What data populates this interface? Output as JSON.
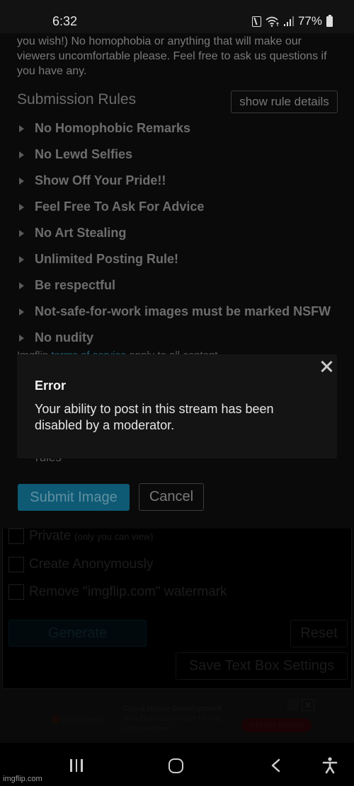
{
  "status_bar": {
    "time": "6:32",
    "battery_percent": "77%",
    "icons": [
      "nfc-icon",
      "wifi-icon",
      "signal-icon",
      "battery-icon"
    ]
  },
  "page": {
    "intro_text": "you wish!) No homophobia or anything that will make our viewers uncomfortable please. Feel free to ask us questions if you have any.",
    "rules_title": "Submission Rules",
    "show_rules_button": "show rule details",
    "rules": [
      {
        "label": "No Homophobic Remarks"
      },
      {
        "label": "No Lewd Selfies"
      },
      {
        "label": "Show Off Your Pride!!"
      },
      {
        "label": "Feel Free To Ask For Advice"
      },
      {
        "label": "No Art Stealing"
      },
      {
        "label": "Unlimited Posting Rule!"
      },
      {
        "label": "Be respectful"
      },
      {
        "label": "Not-safe-for-work images must be marked NSFW"
      },
      {
        "label": "No nudity"
      }
    ],
    "terms_prefix": "Imgflip ",
    "terms_link": "terms of service",
    "terms_suffix": " apply to all content",
    "rules_ack_partial": "rules",
    "submit_button": "Submit Image",
    "cancel_button": "Cancel"
  },
  "generator": {
    "options": [
      {
        "label": "Private",
        "sublabel": "(only you can view)",
        "checked": false
      },
      {
        "label": "Create Anonymously",
        "sublabel": "",
        "checked": false
      },
      {
        "label": "Remove \"imgflip.com\" watermark",
        "sublabel": "",
        "checked": false
      }
    ],
    "generate_button": "Generate",
    "reset_button": "Reset",
    "save_settings_button": "Save Text Box Settings"
  },
  "ad": {
    "brand": "outsystems",
    "headline": "Cloud-Native Development",
    "body": "How Does Low-Code Fit Into Cloud-Native?",
    "cta": "Get the Report",
    "close_label": "✕"
  },
  "dialog": {
    "title": "Error",
    "message": "Your ability to post in this stream has been disabled by a moderator."
  },
  "nav_bar": {
    "watermark": "imgflip.com"
  },
  "colors": {
    "accent": "#0e5a75",
    "dialog_bg": "#141414",
    "page_bg": "#0a0a0a"
  }
}
